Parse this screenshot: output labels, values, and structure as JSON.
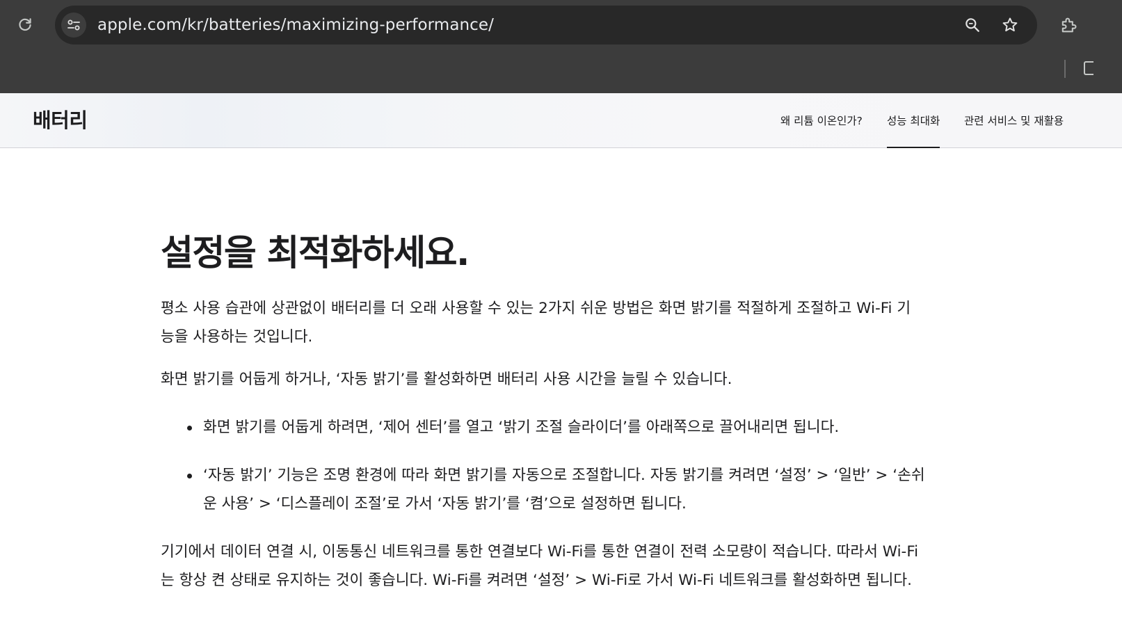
{
  "browser": {
    "url": "apple.com/kr/batteries/maximizing-performance/",
    "icons": [
      "reload-icon",
      "site-info-icon",
      "zoom-icon",
      "bookmark-star-icon",
      "extensions-icon"
    ]
  },
  "localnav": {
    "title": "배터리",
    "links": [
      {
        "label": "왜 리튬 이온인가?",
        "active": false
      },
      {
        "label": "성능 최대화",
        "active": true
      },
      {
        "label": "관련 서비스 및 재활용",
        "active": false
      }
    ]
  },
  "main": {
    "heading": "설정을 최적화하세요.",
    "intro": "평소 사용 습관에 상관없이 배터리를 더 오래 사용할 수 있는 2가지 쉬운 방법은 화면 밝기를 적절하게 조절하고 Wi-Fi 기능을 사용하는 것입니다.",
    "brightness_text": "화면 밝기를 어둡게 하거나, ‘자동 밝기’를 활성화하면 배터리 사용 시간을 늘릴 수 있습니다.",
    "bullets": [
      "화면 밝기를 어둡게 하려면, ‘제어 센터’를 열고 ‘밝기 조절 슬라이더’를 아래쪽으로 끌어내리면 됩니다.",
      "‘자동 밝기’ 기능은 조명 환경에 따라 화면 밝기를 자동으로 조절합니다. 자동 밝기를 켜려면 ‘설정’ > ‘일반’ > ‘손쉬운 사용’ > ‘디스플레이 조절’로 가서 ‘자동 밝기’를 ‘켬’으로 설정하면 됩니다."
    ],
    "wifi_text": "기기에서 데이터 연결 시, 이동통신 네트워크를 통한 연결보다 Wi-Fi를 통한 연결이 전력 소모량이 적습니다. 따라서 Wi-Fi는 항상 켠 상태로 유지하는 것이 좋습니다. Wi-Fi를 켜려면 ‘설정’ > Wi-Fi로 가서 Wi-Fi 네트워크를 활성화하면 됩니다."
  }
}
